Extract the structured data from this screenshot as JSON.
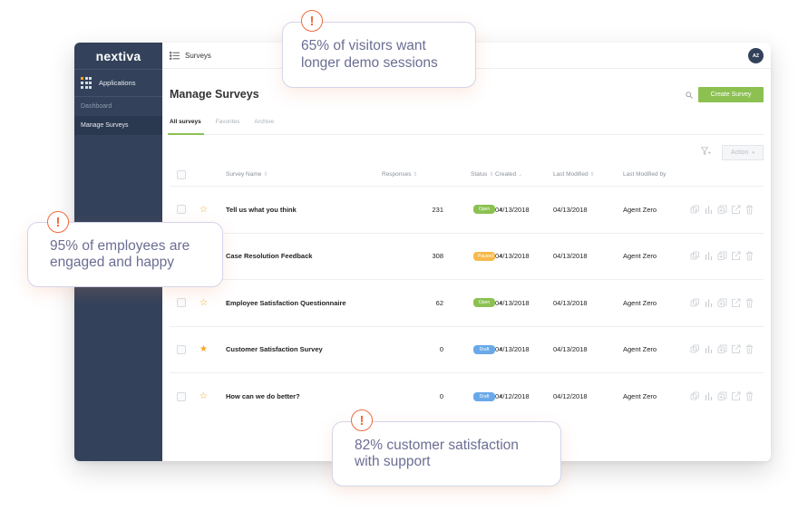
{
  "sidebar": {
    "brand": "nextiva",
    "applications_label": "Applications",
    "items": [
      {
        "label": "Dashboard",
        "active": false
      },
      {
        "label": "Manage Surveys",
        "active": true
      }
    ]
  },
  "topbar": {
    "title": "Surveys",
    "avatar_initials": "AZ"
  },
  "page": {
    "title": "Manage Surveys",
    "create_button": "Create Survey",
    "action_button": "Action",
    "tabs": [
      {
        "label": "All surveys",
        "active": true
      },
      {
        "label": "Favorites",
        "active": false
      },
      {
        "label": "Archive",
        "active": false
      }
    ]
  },
  "table": {
    "headers": {
      "name": "Survey Name",
      "responses": "Responses",
      "status": "Status",
      "created": "Created",
      "last_modified": "Last Modified",
      "last_modified_by": "Last Modified by"
    },
    "rows": [
      {
        "favorite": false,
        "name": "Tell us what you think",
        "responses": "231",
        "status": "Open",
        "created": "04/13/2018",
        "modified": "04/13/2018",
        "by": "Agent Zero"
      },
      {
        "favorite": false,
        "name": "Case Resolution Feedback",
        "responses": "308",
        "status": "Paused",
        "created": "04/13/2018",
        "modified": "04/13/2018",
        "by": "Agent Zero"
      },
      {
        "favorite": false,
        "name": "Employee Satisfaction Questionnaire",
        "responses": "62",
        "status": "Open",
        "created": "04/13/2018",
        "modified": "04/13/2018",
        "by": "Agent Zero"
      },
      {
        "favorite": true,
        "name": "Customer Satisfaction Survey",
        "responses": "0",
        "status": "Draft",
        "created": "04/13/2018",
        "modified": "04/13/2018",
        "by": "Agent Zero"
      },
      {
        "favorite": false,
        "name": "How can we do better?",
        "responses": "0",
        "status": "Draft",
        "created": "04/12/2018",
        "modified": "04/12/2018",
        "by": "Agent Zero"
      }
    ]
  },
  "status_colors": {
    "Open": "#8cc152",
    "Paused": "#f6b94a",
    "Draft": "#6aa9e9"
  },
  "colors": {
    "accent_green": "#8cc152",
    "sidebar_bg": "#33425a",
    "alert_orange": "#f06a3b",
    "callout_text": "#6b6e93"
  },
  "callouts": [
    {
      "text_line1": "65% of visitors want",
      "text_line2": "longer demo sessions"
    },
    {
      "text_line1": "95% of employees are",
      "text_line2": "engaged and happy"
    },
    {
      "text_line1": "82% customer satisfaction",
      "text_line2": "with support"
    }
  ],
  "icons": {
    "alert": "!",
    "star_empty": "☆",
    "star_filled": "★",
    "sort": "⇕",
    "caret": "▾"
  }
}
